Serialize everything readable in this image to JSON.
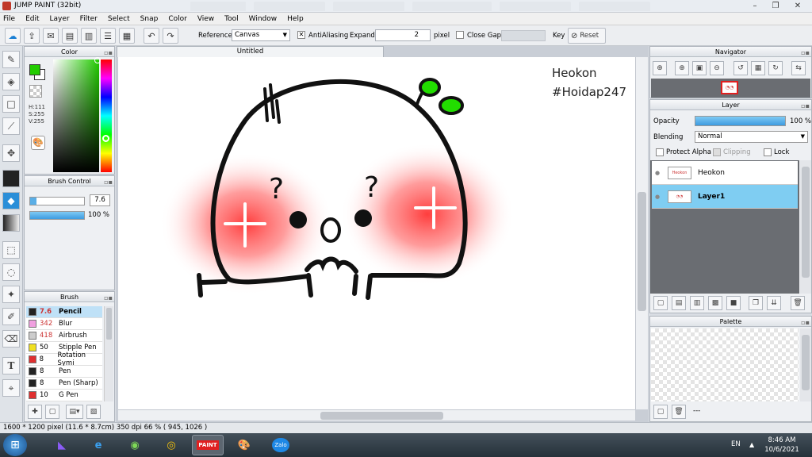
{
  "app": {
    "title": "JUMP PAINT (32bit)"
  },
  "menu": [
    "File",
    "Edit",
    "Layer",
    "Filter",
    "Select",
    "Snap",
    "Color",
    "View",
    "Tool",
    "Window",
    "Help"
  ],
  "toolbar": {
    "reference_label": "Reference",
    "reference_value": "Canvas",
    "antialiasing_label": "AntiAliasing",
    "expand_label": "Expand",
    "expand_value": "2",
    "pixel_label": "pixel",
    "close_gaps_label": "Close Gaps",
    "key_label": "Key",
    "reset_label": "Reset"
  },
  "color_panel": {
    "title": "Color",
    "h": "H:111",
    "s": "S:255",
    "v": "V:255",
    "fg": "#22cc00",
    "bg": "#ffffff"
  },
  "brush_control": {
    "title": "Brush Control",
    "size": "7.6",
    "opacity": "100 %"
  },
  "brush_panel": {
    "title": "Brush",
    "items": [
      {
        "size": "7.6",
        "name": "Pencil",
        "color": "#222222",
        "selected": true
      },
      {
        "size": "342",
        "name": "Blur",
        "color": "#f0a0e0"
      },
      {
        "size": "418",
        "name": "Airbrush",
        "color": "#cccccc"
      },
      {
        "size": "50",
        "name": "Stipple Pen",
        "color": "#f0e020"
      },
      {
        "size": "8",
        "name": "Rotation Symi",
        "color": "#e03030"
      },
      {
        "size": "8",
        "name": "Pen",
        "color": "#222222"
      },
      {
        "size": "8",
        "name": "Pen (Sharp)",
        "color": "#222222"
      },
      {
        "size": "10",
        "name": "G Pen",
        "color": "#e03030"
      }
    ]
  },
  "document": {
    "tab": "Untitled",
    "watermark_line1": "Heokon",
    "watermark_line2": "#Hoidap247"
  },
  "navigator": {
    "title": "Navigator"
  },
  "layer_panel": {
    "title": "Layer",
    "opacity_label": "Opacity",
    "opacity_value": "100 %",
    "blending_label": "Blending",
    "blending_value": "Normal",
    "protect_alpha": "Protect Alpha",
    "clipping": "Clipping",
    "lock": "Lock",
    "layers": [
      {
        "name": "Heokon",
        "selected": false
      },
      {
        "name": "Layer1",
        "selected": true
      }
    ]
  },
  "palette_panel": {
    "title": "Palette",
    "more": "---"
  },
  "status": {
    "text": "1600 * 1200 pixel  (11.6 * 8.7cm)  350 dpi  66 %  ( 945, 1026 )"
  },
  "taskbar": {
    "lang": "EN",
    "time": "8:46 AM",
    "date": "10/6/2021",
    "zalo": "Zalo"
  }
}
